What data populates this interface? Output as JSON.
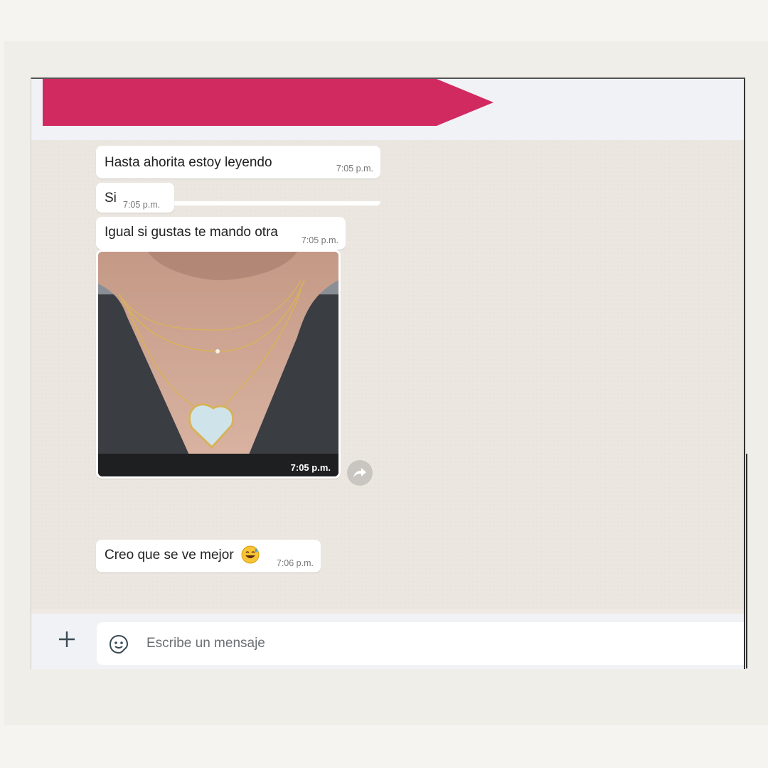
{
  "colors": {
    "banner": "#d12a61",
    "header_bg": "#f0f2f5",
    "chat_bg": "#ebe7e0",
    "bubble_bg": "#ffffff"
  },
  "messages": [
    {
      "text": "Hasta ahorita estoy leyendo",
      "time": "7:05 p.m."
    },
    {
      "text": "Si",
      "time": "7:05 p.m."
    },
    {
      "text": "Igual si gustas te mando otra",
      "time": "7:05 p.m."
    },
    {
      "type": "image",
      "time": "7:05 p.m.",
      "image_subject": "necklace with heart pendant"
    },
    {
      "text": "Creo que se ve mejor",
      "emoji": "grinning-sweat-emoji",
      "time": "7:06 p.m."
    }
  ],
  "composer": {
    "placeholder": "Escribe un mensaje",
    "attach_icon": "plus-icon",
    "sticker_icon": "sticker-icon"
  },
  "image_actions": {
    "forward_icon": "forward-icon"
  }
}
